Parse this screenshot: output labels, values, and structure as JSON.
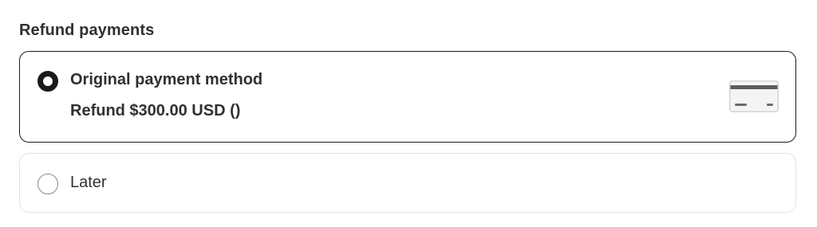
{
  "section": {
    "title": "Refund payments"
  },
  "options": [
    {
      "title": "Original payment method",
      "subtitle": "Refund $300.00 USD ()",
      "selected": true,
      "icon": "credit-card-icon"
    },
    {
      "title": "Later",
      "selected": false
    }
  ],
  "colors": {
    "text": "#303030",
    "selected_border": "#1a1a1a",
    "unselected_border": "#e3e3e3",
    "radio_unselected": "#8a8a8a"
  }
}
